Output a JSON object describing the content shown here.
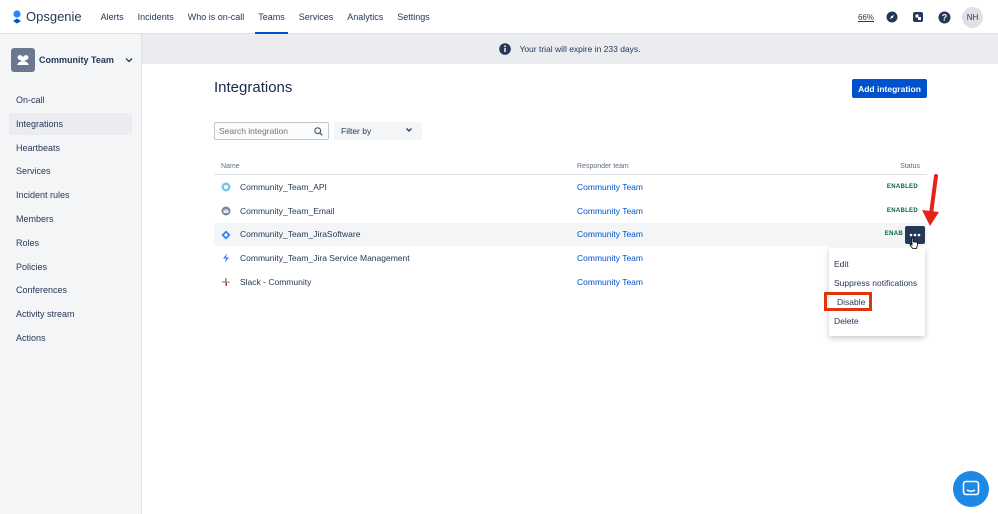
{
  "topnav": {
    "logo_text": "Opsgenie",
    "items": [
      "Alerts",
      "Incidents",
      "Who is on-call",
      "Teams",
      "Services",
      "Analytics",
      "Settings"
    ],
    "active_index": 3,
    "zoom_pct": "66%",
    "avatar_initials": "NH"
  },
  "sidebar": {
    "team_name": "Community Team",
    "items": [
      "On-call",
      "Integrations",
      "Heartbeats",
      "Services",
      "Incident rules",
      "Members",
      "Roles",
      "Policies",
      "Conferences",
      "Activity stream",
      "Actions"
    ],
    "active_index": 1
  },
  "banner": {
    "text": "Your trial will expire in 233 days."
  },
  "main": {
    "title": "Integrations",
    "add_button": "Add integration",
    "search_placeholder": "Search integration",
    "filter_label": "Filter by"
  },
  "table": {
    "headers": {
      "name": "Name",
      "team": "Responder team",
      "status": "Status"
    },
    "rows": [
      {
        "name": "Community_Team_API",
        "team": "Community Team",
        "status": "ENABLED",
        "icon": "api-icon"
      },
      {
        "name": "Community_Team_Email",
        "team": "Community Team",
        "status": "ENABLED",
        "icon": "email-icon"
      },
      {
        "name": "Community_Team_JiraSoftware",
        "team": "Community Team",
        "status": "ENAB",
        "icon": "jira-software-icon"
      },
      {
        "name": "Community_Team_Jira Service Management",
        "team": "Community Team",
        "status": "",
        "icon": "jira-service-management-icon"
      },
      {
        "name": "Slack - Community",
        "team": "Community Team",
        "status": "",
        "icon": "slack-icon"
      }
    ]
  },
  "menu": {
    "items": [
      "Edit",
      "Suppress notifications",
      "Disable",
      "Delete"
    ],
    "highlighted": "Disable"
  },
  "colors": {
    "primary": "#0052CC",
    "enabled_green": "#006644",
    "annotation_red": "#DE350B",
    "chat_blue": "#1E88E5"
  }
}
